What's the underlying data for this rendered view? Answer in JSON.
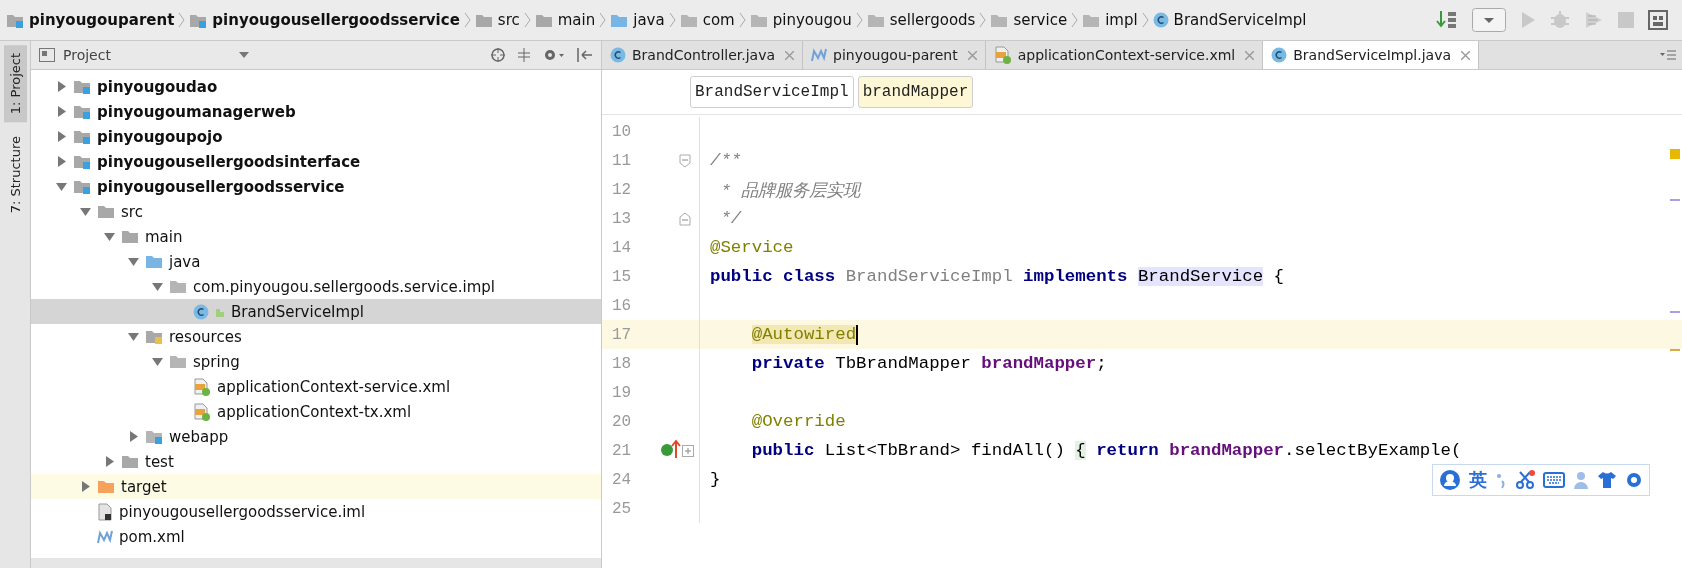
{
  "breadcrumbs": [
    {
      "label": "pinyougouparent",
      "kind": "module"
    },
    {
      "label": "pinyougousellergoodsservice",
      "kind": "module"
    },
    {
      "label": "src",
      "kind": "folder"
    },
    {
      "label": "main",
      "kind": "folder"
    },
    {
      "label": "java",
      "kind": "source"
    },
    {
      "label": "com",
      "kind": "package"
    },
    {
      "label": "pinyougou",
      "kind": "package"
    },
    {
      "label": "sellergoods",
      "kind": "package"
    },
    {
      "label": "service",
      "kind": "package"
    },
    {
      "label": "impl",
      "kind": "package"
    },
    {
      "label": "BrandServiceImpl",
      "kind": "class"
    }
  ],
  "side_tabs": [
    {
      "label": "1: Project",
      "selected": true
    },
    {
      "label": "7: Structure",
      "selected": false
    }
  ],
  "project": {
    "title": "Project",
    "tree": [
      {
        "label": "pinyougoudao",
        "kind": "module",
        "expanded": false,
        "selected": false
      },
      {
        "label": "pinyougoumanagerweb",
        "kind": "module",
        "expanded": false,
        "selected": false
      },
      {
        "label": "pinyougoupojo",
        "kind": "module",
        "expanded": false,
        "selected": false
      },
      {
        "label": "pinyougousellergoodsinterface",
        "kind": "module",
        "expanded": false,
        "selected": false
      },
      {
        "label": "pinyougousellergoodsservice",
        "kind": "module",
        "expanded": true,
        "selected": false,
        "children": [
          {
            "label": "src",
            "kind": "folder",
            "expanded": true,
            "selected": false,
            "children": [
              {
                "label": "main",
                "kind": "folder",
                "expanded": true,
                "selected": false,
                "children": [
                  {
                    "label": "java",
                    "kind": "source",
                    "expanded": true,
                    "selected": false,
                    "children": [
                      {
                        "label": "com.pinyougou.sellergoods.service.impl",
                        "kind": "package",
                        "expanded": true,
                        "selected": false,
                        "children": [
                          {
                            "label": "BrandServiceImpl",
                            "kind": "class",
                            "selected": true
                          }
                        ]
                      }
                    ]
                  },
                  {
                    "label": "resources",
                    "kind": "resources",
                    "expanded": true,
                    "selected": false,
                    "children": [
                      {
                        "label": "spring",
                        "kind": "package",
                        "expanded": true,
                        "selected": false,
                        "children": [
                          {
                            "label": "applicationContext-service.xml",
                            "kind": "xml",
                            "selected": false
                          },
                          {
                            "label": "applicationContext-tx.xml",
                            "kind": "xml",
                            "selected": false
                          }
                        ]
                      }
                    ]
                  },
                  {
                    "label": "webapp",
                    "kind": "webapp",
                    "expanded": false,
                    "selected": false
                  }
                ]
              },
              {
                "label": "test",
                "kind": "folder",
                "expanded": false,
                "selected": false
              }
            ]
          },
          {
            "label": "target",
            "kind": "excluded",
            "expanded": false,
            "selected": false
          },
          {
            "label": "pinyougousellergoodsservice.iml",
            "kind": "iml",
            "selected": false
          },
          {
            "label": "pom.xml",
            "kind": "maven",
            "selected": false
          }
        ]
      }
    ]
  },
  "editor_tabs": [
    {
      "label": "BrandController.java",
      "kind": "class",
      "selected": false
    },
    {
      "label": "pinyougou-parent",
      "kind": "maven",
      "selected": false
    },
    {
      "label": "applicationContext-service.xml",
      "kind": "xml",
      "selected": false
    },
    {
      "label": "BrandServiceImpl.java",
      "kind": "class",
      "selected": true
    }
  ],
  "code_breadcrumbs": [
    {
      "label": "BrandServiceImpl",
      "selected": false
    },
    {
      "label": "brandMapper",
      "selected": true
    }
  ],
  "code": [
    {
      "number": "10"
    },
    {
      "number": "11",
      "fold_start": true,
      "tokens": [
        {
          "text": "/**",
          "kind": "comment"
        }
      ]
    },
    {
      "number": "12",
      "tokens": [
        {
          "text": " * 品牌服务层实现",
          "kind": "comment"
        }
      ]
    },
    {
      "number": "13",
      "fold_end": true,
      "tokens": [
        {
          "text": " */",
          "kind": "comment"
        }
      ]
    },
    {
      "number": "14",
      "tokens": [
        {
          "text": "@Service",
          "kind": "annotation"
        }
      ]
    },
    {
      "number": "15",
      "tokens": [
        {
          "text": "public class",
          "kind": "keyword"
        },
        {
          "text": " BrandServiceImpl ",
          "kind": "unused"
        },
        {
          "text": "implements ",
          "kind": "keyword"
        },
        {
          "text": "BrandService",
          "kind": "reference"
        },
        {
          "text": " {",
          "kind": "plain"
        }
      ]
    },
    {
      "number": "16"
    },
    {
      "number": "17",
      "indented": true,
      "current": true,
      "tokens": [
        {
          "text": "@Autowired",
          "kind": "matched-annotation"
        }
      ]
    },
    {
      "number": "18",
      "indented": true,
      "tokens": [
        {
          "text": "private",
          "kind": "keyword"
        },
        {
          "text": " TbBrandMapper ",
          "kind": "plain"
        },
        {
          "text": "brandMapper",
          "kind": "field"
        },
        {
          "text": ";",
          "kind": "plain"
        }
      ]
    },
    {
      "number": "19"
    },
    {
      "number": "20",
      "indented": true,
      "tokens": [
        {
          "text": "@Override",
          "kind": "annotation"
        }
      ]
    },
    {
      "number": "21",
      "indented": true,
      "collapsed": true,
      "implements": true,
      "tokens": [
        {
          "text": "public",
          "kind": "keyword"
        },
        {
          "text": " List<TbBrand> findAll() ",
          "kind": "plain"
        },
        {
          "text": "{",
          "kind": "folded"
        },
        {
          "text": " return ",
          "kind": "keyword"
        },
        {
          "text": "brandMapper",
          "kind": "field"
        },
        {
          "text": ".selectByExample(",
          "kind": "plain"
        }
      ]
    },
    {
      "number": "24",
      "tokens": [
        {
          "text": "}",
          "kind": "plain"
        }
      ]
    },
    {
      "number": "25"
    }
  ],
  "ime_toolbar": {
    "mode": "英"
  }
}
